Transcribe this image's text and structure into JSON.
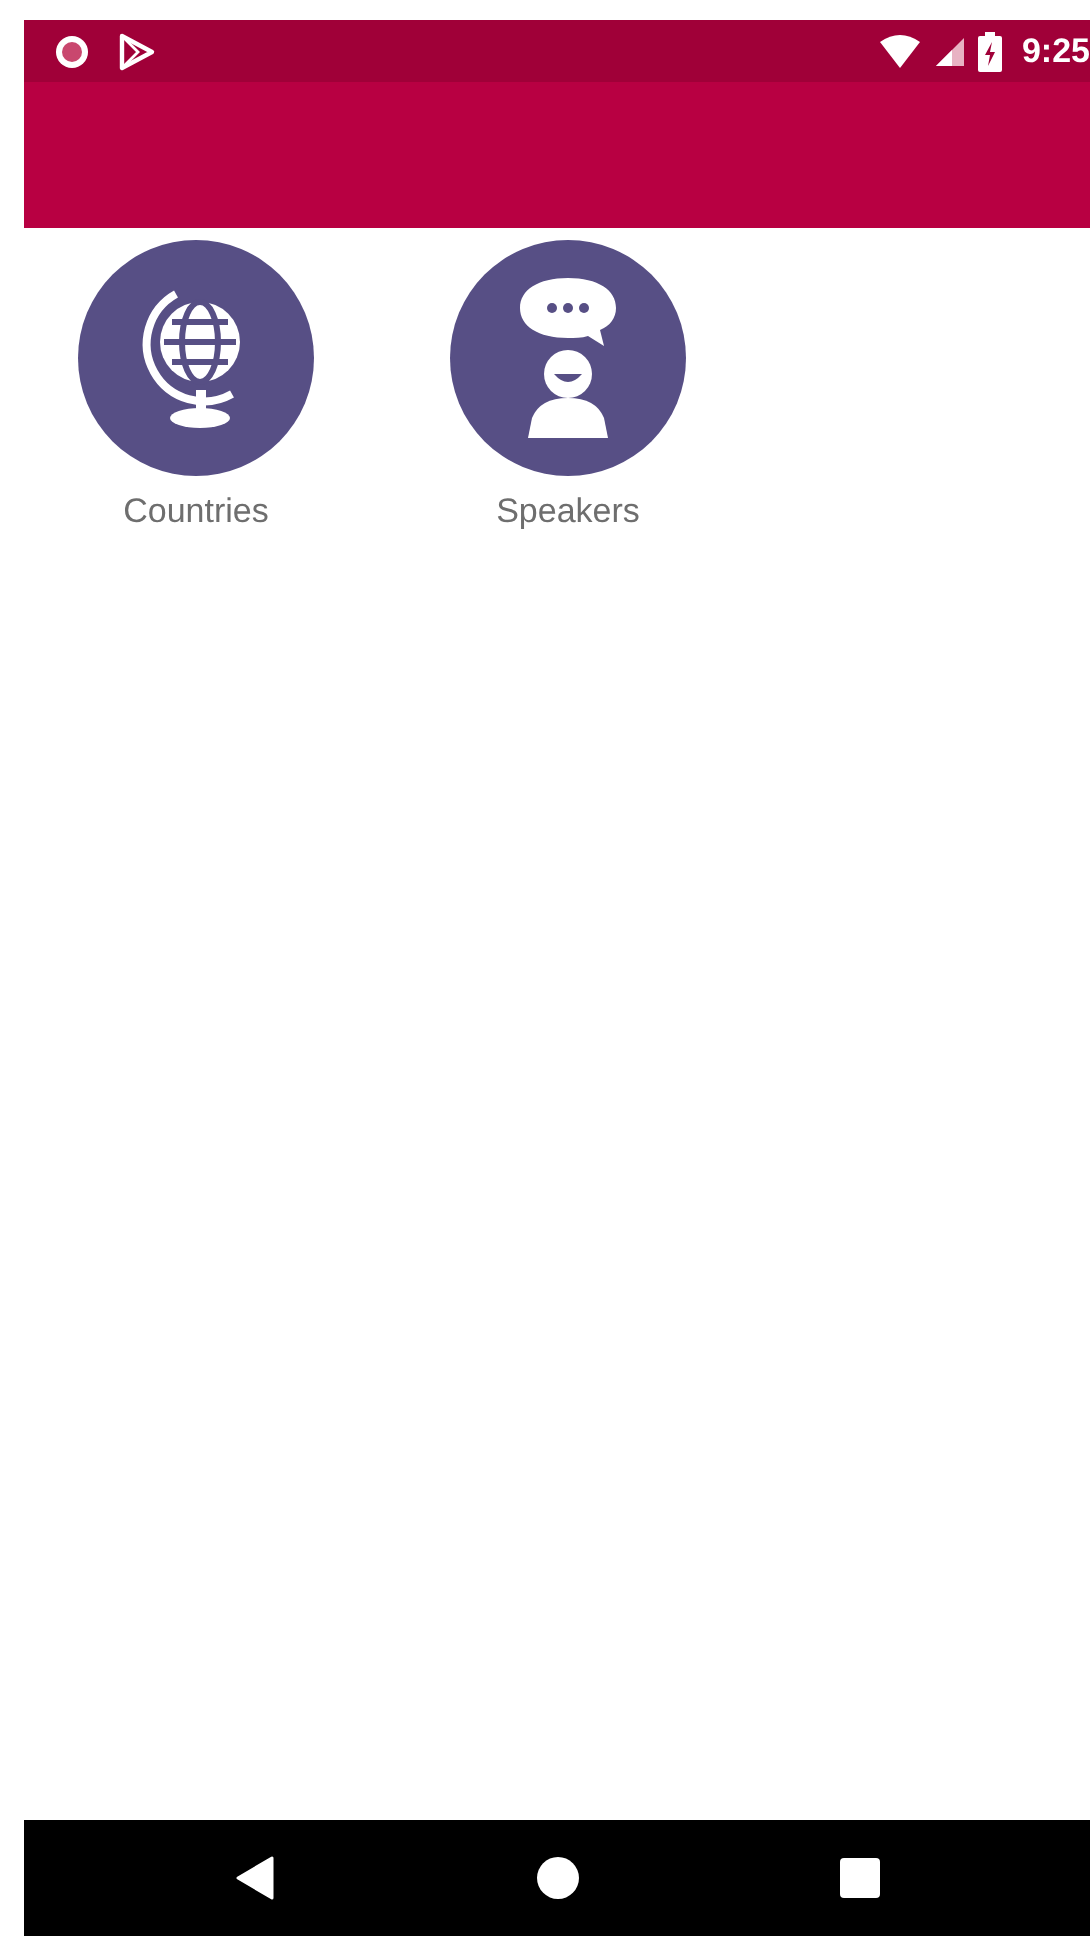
{
  "status_bar": {
    "time": "9:25"
  },
  "tiles": [
    {
      "label": "Countries",
      "kind": "globe"
    },
    {
      "label": "Speakers",
      "kind": "speaker"
    }
  ]
}
